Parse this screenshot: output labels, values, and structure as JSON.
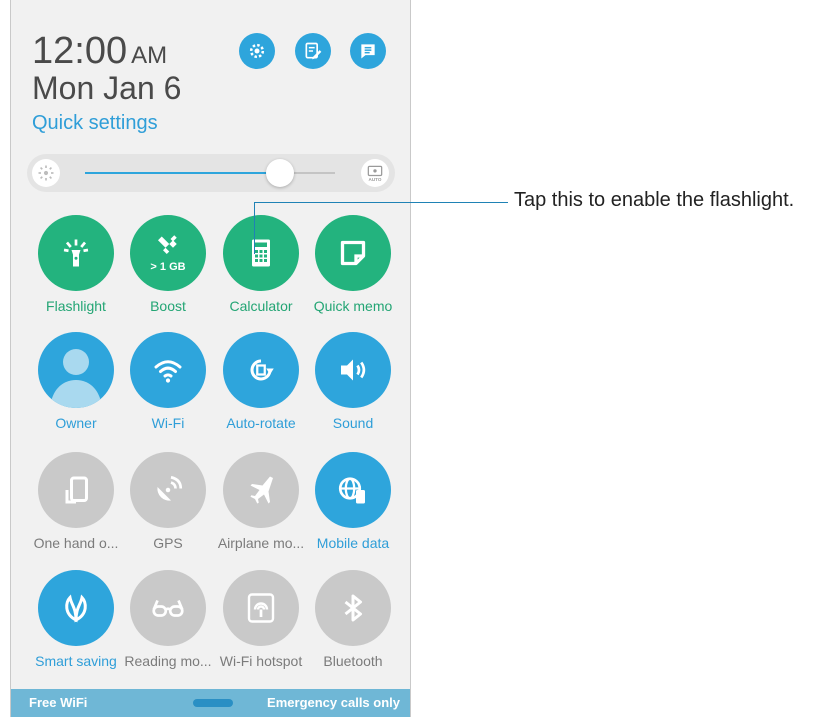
{
  "header": {
    "time": "12:00",
    "ampm": "AM",
    "date": "Mon Jan 6",
    "quick_settings_label": "Quick settings",
    "buttons": [
      "settings-icon",
      "edit-icon",
      "notes-icon"
    ]
  },
  "brightness": {
    "level_fraction": 0.78,
    "auto_label": "AUTO"
  },
  "tiles": [
    {
      "label": "Flashlight",
      "icon": "flashlight-icon",
      "state": "active-green"
    },
    {
      "label": "Boost",
      "sublabel": "> 1 GB",
      "icon": "boost-icon",
      "state": "active-green"
    },
    {
      "label": "Calculator",
      "icon": "calculator-icon",
      "state": "active-green"
    },
    {
      "label": "Quick memo",
      "icon": "memo-icon",
      "state": "active-green"
    },
    {
      "label": "Owner",
      "icon": "avatar-icon",
      "state": "active-blue"
    },
    {
      "label": "Wi-Fi",
      "icon": "wifi-icon",
      "state": "active-blue"
    },
    {
      "label": "Auto-rotate",
      "icon": "auto-rotate-icon",
      "state": "active-blue"
    },
    {
      "label": "Sound",
      "icon": "sound-icon",
      "state": "active-blue"
    },
    {
      "label": "One hand o...",
      "icon": "one-hand-icon",
      "state": "inactive"
    },
    {
      "label": "GPS",
      "icon": "gps-icon",
      "state": "inactive"
    },
    {
      "label": "Airplane mo...",
      "icon": "airplane-icon",
      "state": "inactive"
    },
    {
      "label": "Mobile data",
      "icon": "mobile-data-icon",
      "state": "active-blue"
    },
    {
      "label": "Smart saving",
      "icon": "leaf-icon",
      "state": "active-blue"
    },
    {
      "label": "Reading mo...",
      "icon": "glasses-icon",
      "state": "inactive"
    },
    {
      "label": "Wi-Fi hotspot",
      "icon": "hotspot-icon",
      "state": "inactive"
    },
    {
      "label": "Bluetooth",
      "icon": "bluetooth-icon",
      "state": "inactive"
    }
  ],
  "bottom_bar": {
    "left": "Free WiFi",
    "right": "Emergency calls only"
  },
  "callout": {
    "text": "Tap this to enable the flashlight."
  },
  "colors": {
    "green": "#23b37e",
    "blue": "#2ea5dc",
    "gray": "#c9c9c9",
    "panel": "#f1f1f1"
  }
}
